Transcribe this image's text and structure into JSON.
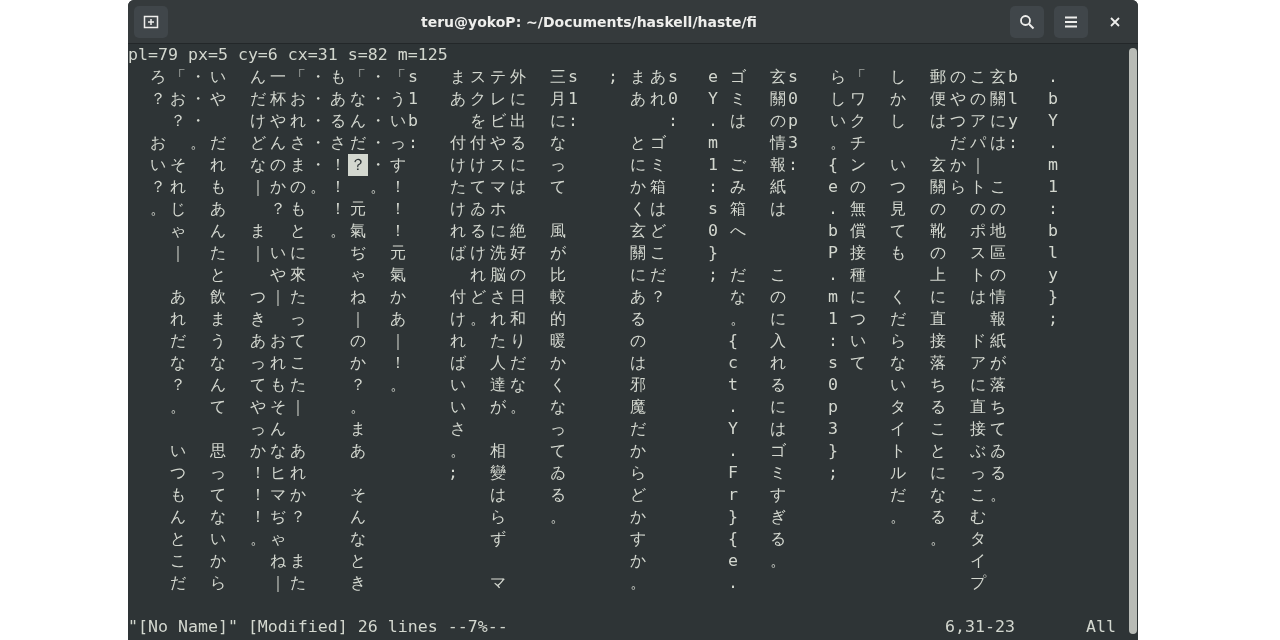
{
  "window": {
    "title": "teru@yokoP: ~/Documents/haskell/haste/fi"
  },
  "message_line": "pl=79 px=5 cy=6 cx=31 s=82 m=125",
  "lines": [
    {
      "text": "  ろ「・い  ん一「・も「・「s   まステ外  三s   ; まあs   e ゴ  玄s   ら「  し  郵のこ玄b   ."
    },
    {
      "text": "  ？お・や  だ杯お・あな・う1   あクレに  月1     あれ0   Y ミ  關0   しワ  か  便やの關l   b"
    },
    {
      "text": "    ？・    けやれ・るん・いb     をビ出  に:         :   . は  のp   いク  し  はつアにy   Y"
    },
    {
      "text": "  お  。だ  どんさ・さだ・っ:   付付やる  な      とゴ    m     情3   。チ        だパは:   ."
    },
    {
      "text": "  いそ  れ  なのま・！",
      "cursor": "？",
      "after": "・す    けけスに  っ      にミ    1 ご  報:   { ン  い  玄か｜      m"
    },
    {
      "text": "  ？れ  も  ｜かの。！  。！    たてマは  て      か箱    : み  紙    e の  つ  關らトこ    1"
    },
    {
      "text": "  。じ  あ    ？も  ！元  ！    けゐホ",
      "more": [
        "            くは    s 箱  は    . 無  見  の  のの    :"
      ]
    },
    {
      "text": "    ゃ  ん  ま  と  。氣  ！    れるに絶  風      玄ど    0 へ        b 償  て  靴  ポ地    b"
    },
    {
      "text": "    ｜  た  ｜いに    ぢ  元    ばけ洗好  が      關こ    }",
      "more": [
        "           P 接  も  の  ス區    l"
      ]
    },
    {
      "text": "        と    や來    ゃ  氣      れ脳の  比      にだ    ; だ  こ    . 種      上  トの    y"
    },
    {
      "text": "    あ  飲  つ｜た    ね  か    付どさ日  較      あ？      な  の    m に  く  に  は情    }"
    },
    {
      "text": "    れ  ま  き  っ    ｜  あ    け。れ和  的      る        。  に    1 つ  だ  直    報    ;"
    },
    {
      "text": "    だ  う  あおて    の  ｜    れ  たり  暖      の        {   入    : い  ら  接  ド紙"
    },
    {
      "text": "    な  な  っれこ    か  ！    ば  人だ  か      は        c   れ    s て  な  落  アが"
    },
    {
      "text": "    ？  ん  てもた    ？  。    い  達な  く      邪        t   る    0     い  ち  に落"
    },
    {
      "text": "    。  て  やそ｜    。        い  が。  な      魔        .   に    p     タ  る  直ち"
    },
    {
      "text": "            っん      ま        さ        っ      だ        Y   は    3     イ  こ  接て"
    },
    {
      "text": "    い  思  かなあ    あ        。  相    て      か        .   ゴ    }     ト  と  ぶゐ"
    },
    {
      "text": "    つ  っ  ！ヒれ",
      "more": [
        "              ;   變    ゐ      ら        F   ミ    ;     ル  に  っる"
      ]
    },
    {
      "text": "    も  て  ！マか    そ",
      "more": [
        "            は    る      ど        r   す",
        "          だ  な  こ。"
      ]
    },
    {
      "text": "    ん  な  ！ぢ？    ん",
      "more": [
        "            ら    。      か        }   ぎ",
        "          。  る  む"
      ]
    },
    {
      "text": "    と  い  。ゃ      な",
      "more": [
        "            ず",
        "            す        {   る",
        "              。  タ"
      ]
    },
    {
      "text": "    こ  か    ねま    と",
      "more": [
        "                          か        e   。",
        "                  イ"
      ]
    },
    {
      "text": "    だ  ら    ｜た    き",
      "more": [
        "            マ",
        "            。        .",
        "                       プ"
      ]
    }
  ],
  "status_bar": {
    "file": "\"[No Name]\" [Modified] 26 lines --7%--",
    "position": "6,31-23",
    "scroll": "All"
  }
}
